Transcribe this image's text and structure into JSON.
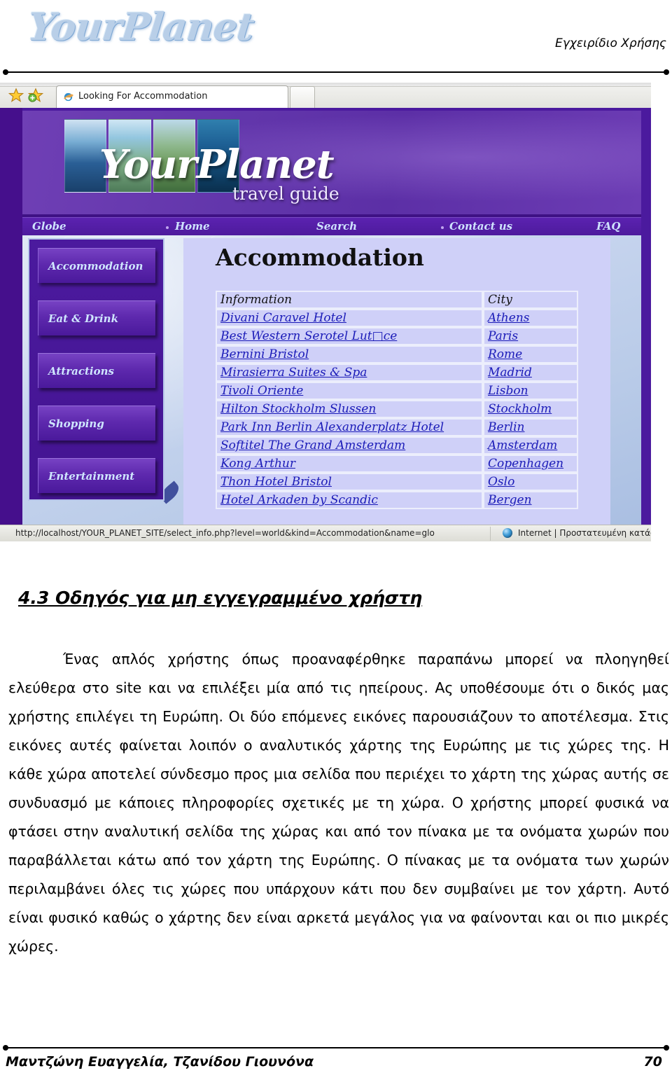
{
  "page_header": {
    "logo_text": "YourPlanet",
    "manual_title": "Εγχειρίδιο Χρήσης"
  },
  "browser": {
    "favorites_icon": "star-icon",
    "add_favorite_icon": "add-favorite-star-icon",
    "tab": {
      "icon": "internet-explorer-icon",
      "title": "Looking For Accommodation"
    },
    "new_tab_label": "",
    "statusbar": {
      "url": "http://localhost/YOUR_PLANET_SITE/select_info.php?level=world&kind=Accommodation&name=glo",
      "zone_icon": "globe-icon",
      "zone_text": "Internet | Προστατευμένη κατάσ"
    }
  },
  "site": {
    "banner": {
      "script_text": "YourPlanet",
      "subtitle": "travel guide"
    },
    "nav": [
      {
        "label": "Globe"
      },
      {
        "label": "Home"
      },
      {
        "label": "Search"
      },
      {
        "label": "Contact us"
      },
      {
        "label": "FAQ"
      }
    ],
    "sidebar": [
      {
        "label": "Accommodation"
      },
      {
        "label": "Eat & Drink"
      },
      {
        "label": "Attractions"
      },
      {
        "label": "Shopping"
      },
      {
        "label": "Entertainment"
      }
    ],
    "content": {
      "title": "Accommodation",
      "table": {
        "headers": [
          "Information",
          "City"
        ],
        "rows": [
          {
            "info": "Divani Caravel Hotel",
            "city": "Athens"
          },
          {
            "info": "Best Western Serotel Lut□ce",
            "city": "Paris"
          },
          {
            "info": "Bernini Bristol",
            "city": "Rome"
          },
          {
            "info": "Mirasierra Suites & Spa",
            "city": "Madrid"
          },
          {
            "info": "Tivoli Oriente",
            "city": "Lisbon"
          },
          {
            "info": "Hilton Stockholm Slussen",
            "city": "Stockholm"
          },
          {
            "info": "Park Inn Berlin Alexanderplatz Hotel",
            "city": "Berlin"
          },
          {
            "info": "Softitel The Grand Amsterdam",
            "city": "Amsterdam"
          },
          {
            "info": "Kong Arthur",
            "city": "Copenhagen"
          },
          {
            "info": "Thon Hotel Bristol",
            "city": "Oslo"
          },
          {
            "info": "Hotel Arkaden by Scandic",
            "city": "Bergen"
          }
        ]
      }
    }
  },
  "document": {
    "heading": "4.3 Οδηγός για μη εγγεγραμμένο χρήστη",
    "paragraph": "Ένας απλός χρήστης όπως προαναφέρθηκε παραπάνω μπορεί να πλοηγηθεί ελεύθερα στο site και να επιλέξει μία από τις ηπείρους. Ας υποθέσουμε ότι ο δικός μας χρήστης επιλέγει τη Ευρώπη. Οι δύο επόμενες εικόνες παρουσιάζουν το αποτέλεσμα. Στις εικόνες αυτές φαίνεται λοιπόν ο αναλυτικός χάρτης της Ευρώπης με τις χώρες της. Η κάθε χώρα αποτελεί σύνδεσμο προς μια σελίδα που περιέχει το χάρτη της χώρας αυτής σε συνδυασμό με κάποιες πληροφορίες σχετικές με τη χώρα. Ο χρήστης μπορεί φυσικά να φτάσει στην αναλυτική σελίδα της χώρας και από τον πίνακα με τα ονόματα χωρών που παραβάλλεται κάτω από τον χάρτη της Ευρώπης. Ο πίνακας με τα ονόματα των χωρών περιλαμβάνει όλες τις χώρες που υπάρχουν κάτι που δεν συμβαίνει με τον χάρτη. Αυτό είναι φυσικό καθώς ο χάρτης δεν είναι αρκετά μεγάλος για να φαίνονται και οι πιο μικρές χώρες."
  },
  "footer": {
    "authors": "Μαντζώνη Ευαγγελία, Τζανίδου Γιουνόνα",
    "page_number": "70"
  }
}
